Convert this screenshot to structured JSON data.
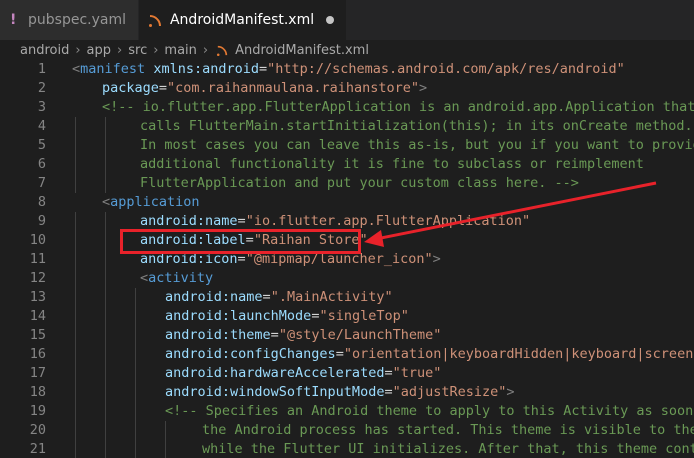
{
  "tabs": [
    {
      "label": "pubspec.yaml",
      "icon": "exclamation-icon",
      "active": false
    },
    {
      "label": "AndroidManifest.xml",
      "icon": "rss-icon",
      "active": true,
      "modified": true
    }
  ],
  "breadcrumb": [
    "android",
    "app",
    "src",
    "main",
    "AndroidManifest.xml"
  ],
  "annotation": {
    "color": "#e8222a"
  },
  "lines": [
    {
      "n": "1",
      "indent": 0,
      "tokens": [
        [
          "t-punc",
          "<"
        ],
        [
          "t-tag",
          "manifest"
        ],
        [
          "t-txt",
          " "
        ],
        [
          "t-attr",
          "xmlns:android"
        ],
        [
          "t-txt",
          "="
        ],
        [
          "t-str",
          "\"http://schemas.android.com/apk/res/android\""
        ]
      ]
    },
    {
      "n": "2",
      "indent": 1,
      "tokens": [
        [
          "t-attr",
          "package"
        ],
        [
          "t-txt",
          "="
        ],
        [
          "t-str",
          "\"com.raihanmaulana.raihanstore\""
        ],
        [
          "t-punc",
          ">"
        ]
      ]
    },
    {
      "n": "3",
      "indent": 1,
      "tokens": [
        [
          "t-com",
          "<!-- io.flutter.app.FlutterApplication is an android.app.Application that"
        ]
      ]
    },
    {
      "n": "4",
      "indent": 2,
      "tokens": [
        [
          "t-com",
          "calls FlutterMain.startInitialization(this); in its onCreate method."
        ]
      ]
    },
    {
      "n": "5",
      "indent": 2,
      "tokens": [
        [
          "t-com",
          "In most cases you can leave this as-is, but you if you want to provide"
        ]
      ]
    },
    {
      "n": "6",
      "indent": 2,
      "tokens": [
        [
          "t-com",
          "additional functionality it is fine to subclass or reimplement"
        ]
      ]
    },
    {
      "n": "7",
      "indent": 2,
      "tokens": [
        [
          "t-com",
          "FlutterApplication and put your custom class here. -->"
        ]
      ]
    },
    {
      "n": "8",
      "indent": 1,
      "tokens": [
        [
          "t-punc",
          "<"
        ],
        [
          "t-tag",
          "application"
        ]
      ]
    },
    {
      "n": "9",
      "indent": 2,
      "tokens": [
        [
          "t-attr",
          "android:name"
        ],
        [
          "t-txt",
          "="
        ],
        [
          "t-str",
          "\"io.flutter.app.FlutterApplication\""
        ]
      ]
    },
    {
      "n": "10",
      "indent": 2,
      "tokens": [
        [
          "t-attr",
          "android:label"
        ],
        [
          "t-txt",
          "="
        ],
        [
          "t-str",
          "\"Raihan Store\""
        ]
      ]
    },
    {
      "n": "11",
      "indent": 2,
      "tokens": [
        [
          "t-attr",
          "android:icon"
        ],
        [
          "t-txt",
          "="
        ],
        [
          "t-str",
          "\"@mipmap/launcher_icon\""
        ],
        [
          "t-punc",
          ">"
        ]
      ]
    },
    {
      "n": "12",
      "indent": 2,
      "tokens": [
        [
          "t-punc",
          "<"
        ],
        [
          "t-tag",
          "activity"
        ]
      ]
    },
    {
      "n": "13",
      "indent": 3,
      "tokens": [
        [
          "t-attr",
          "android:name"
        ],
        [
          "t-txt",
          "="
        ],
        [
          "t-str",
          "\".MainActivity\""
        ]
      ]
    },
    {
      "n": "14",
      "indent": 3,
      "tokens": [
        [
          "t-attr",
          "android:launchMode"
        ],
        [
          "t-txt",
          "="
        ],
        [
          "t-str",
          "\"singleTop\""
        ]
      ]
    },
    {
      "n": "15",
      "indent": 3,
      "tokens": [
        [
          "t-attr",
          "android:theme"
        ],
        [
          "t-txt",
          "="
        ],
        [
          "t-str",
          "\"@style/LaunchTheme\""
        ]
      ]
    },
    {
      "n": "16",
      "indent": 3,
      "tokens": [
        [
          "t-attr",
          "android:configChanges"
        ],
        [
          "t-txt",
          "="
        ],
        [
          "t-str",
          "\"orientation|keyboardHidden|keyboard|screenSize"
        ]
      ]
    },
    {
      "n": "17",
      "indent": 3,
      "tokens": [
        [
          "t-attr",
          "android:hardwareAccelerated"
        ],
        [
          "t-txt",
          "="
        ],
        [
          "t-str",
          "\"true\""
        ]
      ]
    },
    {
      "n": "18",
      "indent": 3,
      "tokens": [
        [
          "t-attr",
          "android:windowSoftInputMode"
        ],
        [
          "t-txt",
          "="
        ],
        [
          "t-str",
          "\"adjustResize\""
        ],
        [
          "t-punc",
          ">"
        ]
      ]
    },
    {
      "n": "19",
      "indent": 3,
      "tokens": [
        [
          "t-com",
          "<!-- Specifies an Android theme to apply to this Activity as soon as"
        ]
      ]
    },
    {
      "n": "20",
      "indent": 4,
      "tokens": [
        [
          "t-com",
          "the Android process has started. This theme is visible to the us"
        ]
      ]
    },
    {
      "n": "21",
      "indent": 4,
      "tokens": [
        [
          "t-com",
          "while the Flutter UI initializes. After that, this theme continu"
        ]
      ]
    }
  ]
}
